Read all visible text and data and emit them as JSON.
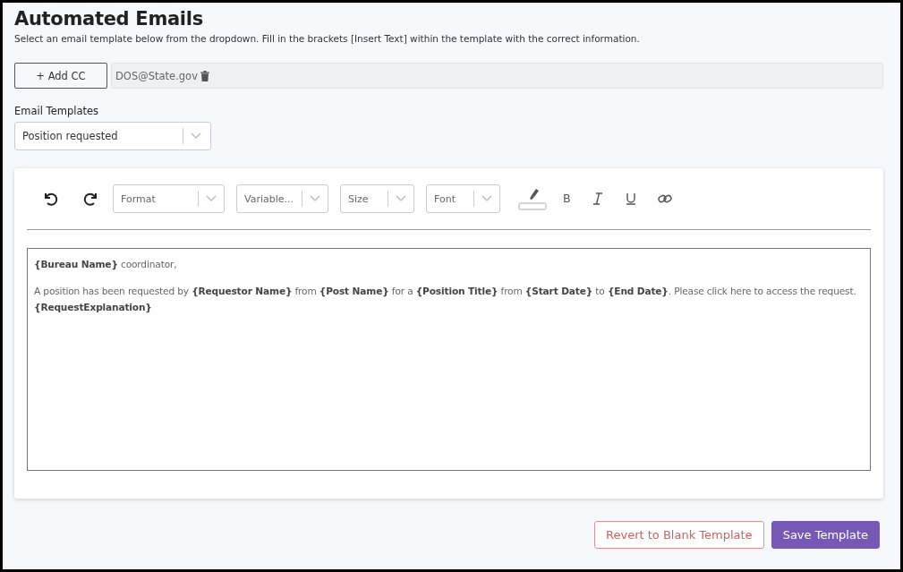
{
  "header": {
    "title": "Automated Emails",
    "subtitle": "Select an email template below from the dropdown. Fill in the brackets [Insert Text] within the template with the correct information."
  },
  "cc": {
    "add_button": "+ Add CC",
    "emails": [
      "DOS@State.gov"
    ]
  },
  "templates": {
    "label": "Email Templates",
    "value": "Position requested"
  },
  "toolbar": {
    "dropdowns": [
      {
        "placeholder": "Format"
      },
      {
        "placeholder": "Variable..."
      },
      {
        "placeholder": "Size"
      },
      {
        "placeholder": "Font"
      }
    ],
    "buttons": [
      {
        "kind": "highlight"
      },
      {
        "kind": "bold",
        "glyph": "B"
      },
      {
        "kind": "italic"
      },
      {
        "kind": "underline"
      },
      {
        "kind": "link"
      }
    ]
  },
  "editor": {
    "paragraphs": [
      {
        "lines": [
          "**{Bureau Name}** coordinator,"
        ]
      },
      {
        "lines": [
          "A position has been requested by **{Requestor Name}** from **{Post Name}** for a **{Position Title}** from **{Start Date}** to **{End Date}**. Please click here to access the request.",
          "**{RequestExplanation}**"
        ]
      }
    ]
  },
  "actions": [
    {
      "label": "Revert to Blank Template",
      "kind": "secondary"
    },
    {
      "label": "Save Template",
      "kind": "primary"
    }
  ]
}
